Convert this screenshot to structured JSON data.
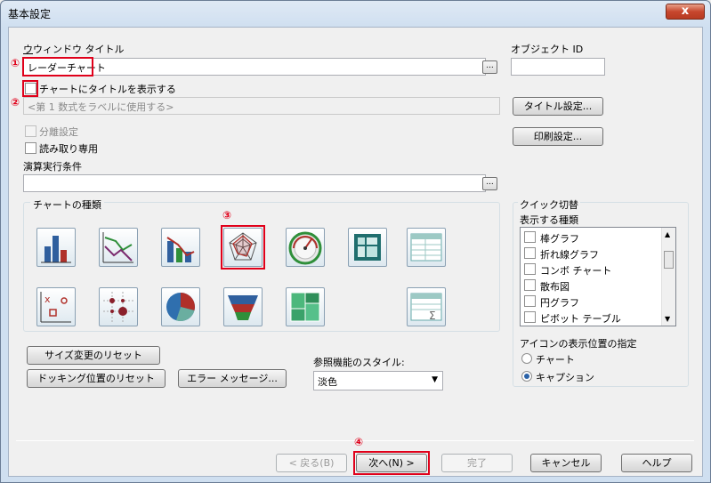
{
  "window": {
    "title": "基本設定",
    "close_symbol": "x"
  },
  "window_title_field": {
    "label": "ウィンドウ タイトル",
    "value": "レーダーチャート"
  },
  "object_id": {
    "label": "オブジェクト ID",
    "value": ""
  },
  "show_title_checkbox": {
    "label": "チャートにタイトルを表示する",
    "checked": false
  },
  "title_formula_field": {
    "value": "<第 1 数式をラベルに使用する>"
  },
  "buttons": {
    "title_settings": "タイトル設定...",
    "print_settings": "印刷設定...",
    "dots": "...",
    "reset_size": "サイズ変更のリセット",
    "reset_docking": "ドッキング位置のリセット",
    "error_message": "エラー メッセージ...",
    "back": "< 戻る(B)",
    "next": "次へ(N) >",
    "finish": "完了",
    "cancel": "キャンセル",
    "help": "ヘルプ"
  },
  "separate_setting": {
    "label": "分離設定",
    "checked": false
  },
  "read_only": {
    "label": "読み取り専用",
    "checked": false
  },
  "calc_condition": {
    "label": "演算実行条件",
    "value": ""
  },
  "chart_types": {
    "label": "チャートの種類",
    "icons": [
      "bar-chart-icon",
      "line-chart-icon",
      "combo-chart-icon",
      "radar-chart-icon",
      "gauge-chart-icon",
      "pivot-table-icon",
      "table-box-icon",
      "scatter-chart-icon",
      "grid-chart-icon",
      "pie-chart-icon",
      "funnel-chart-icon",
      "block-chart-icon",
      "straight-table-icon"
    ]
  },
  "quick_switch": {
    "label": "クイック切替",
    "types_label": "表示する種類",
    "items": [
      "棒グラフ",
      "折れ線グラフ",
      "コンボ チャート",
      "散布図",
      "円グラフ",
      "ピボット テーブル"
    ]
  },
  "icon_position": {
    "label": "アイコンの表示位置の指定",
    "options": [
      "チャート",
      "キャプション"
    ],
    "selected": "キャプション"
  },
  "lookup_style": {
    "label": "参照機能のスタイル:",
    "value": "淡色"
  },
  "markers": [
    "①",
    "②",
    "③",
    "④"
  ],
  "colors": {
    "marker_red": "#e0001a",
    "accent_blue": "#2b62a8"
  }
}
